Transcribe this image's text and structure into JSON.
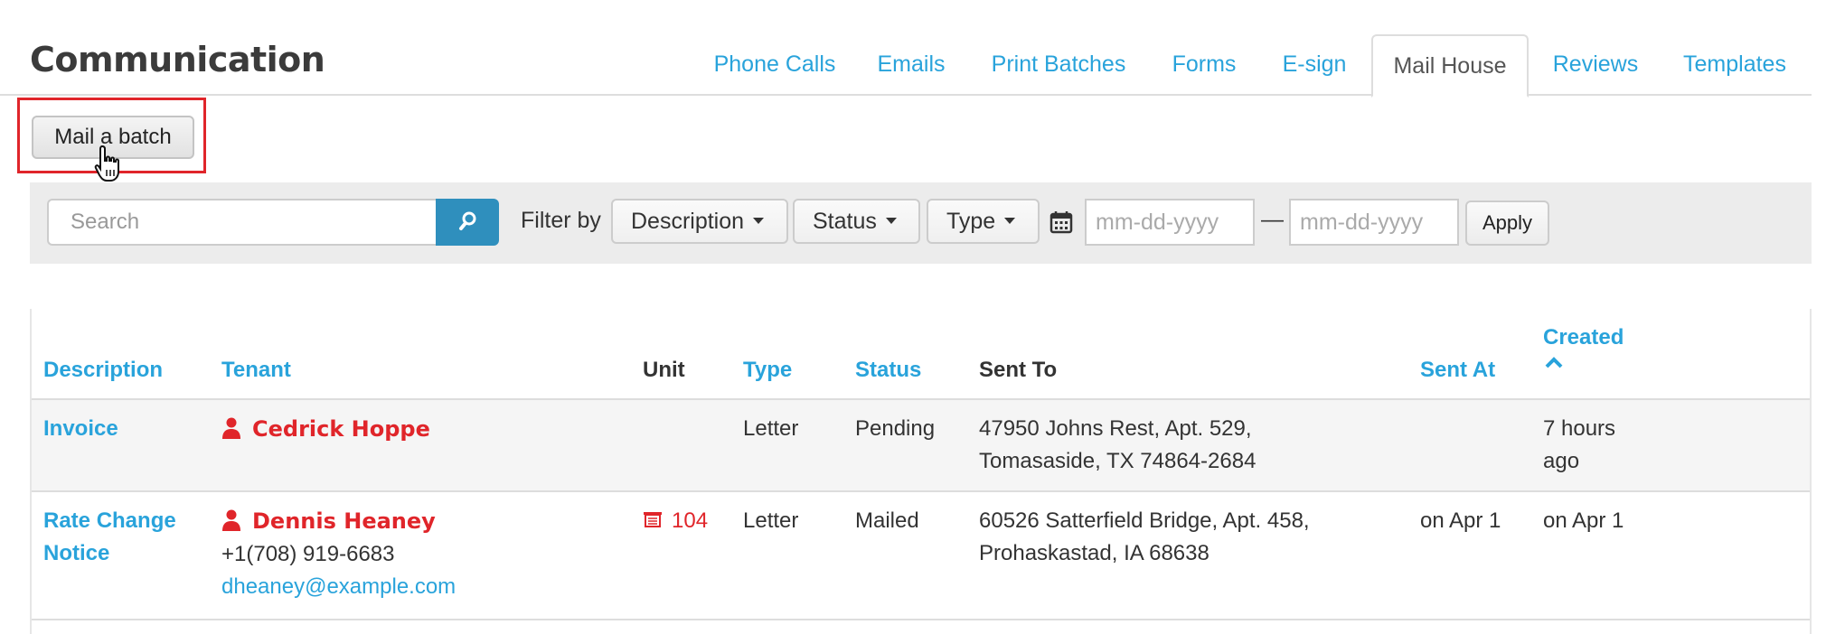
{
  "page_title": "Communication",
  "tabs": [
    {
      "label": "Phone Calls"
    },
    {
      "label": "Emails"
    },
    {
      "label": "Print Batches"
    },
    {
      "label": "Forms"
    },
    {
      "label": "E-sign"
    },
    {
      "label": "Mail House",
      "active": true
    },
    {
      "label": "Reviews"
    },
    {
      "label": "Templates"
    }
  ],
  "actions": {
    "mail_batch_label": "Mail a batch"
  },
  "filter": {
    "search_placeholder": "Search",
    "filter_by_label": "Filter by",
    "description_label": "Description",
    "status_label": "Status",
    "type_label": "Type",
    "date_from_placeholder": "mm-dd-yyyy",
    "date_separator": "—",
    "date_to_placeholder": "mm-dd-yyyy",
    "apply_label": "Apply"
  },
  "table": {
    "headers": {
      "description": "Description",
      "tenant": "Tenant",
      "unit": "Unit",
      "type": "Type",
      "status": "Status",
      "sent_to": "Sent To",
      "sent_at": "Sent At",
      "created": "Created"
    },
    "rows": [
      {
        "description": "Invoice",
        "tenant_name": "Cedrick Hoppe",
        "tenant_phone": "",
        "tenant_email": "",
        "unit": "",
        "type": "Letter",
        "status": "Pending",
        "sent_to_line1": "47950 Johns Rest, Apt. 529,",
        "sent_to_line2": "Tomasaside, TX 74864-2684",
        "sent_at": "",
        "created_line1": "7 hours",
        "created_line2": "ago"
      },
      {
        "description_line1": "Rate Change",
        "description_line2": "Notice",
        "tenant_name": "Dennis Heaney",
        "tenant_phone": "+1(708) 919-6683",
        "tenant_email": "dheaney@example.com",
        "unit": "104",
        "type": "Letter",
        "status": "Mailed",
        "sent_to_line1": "60526 Satterfield Bridge, Apt. 458,",
        "sent_to_line2": "Prohaskastad, IA 68638",
        "sent_at": "on Apr 1",
        "created": "on Apr 1"
      }
    ]
  },
  "colors": {
    "link": "#29a3db",
    "tenant": "#e0252a",
    "highlight": "#e0252a",
    "search_button": "#2f8fbd"
  }
}
